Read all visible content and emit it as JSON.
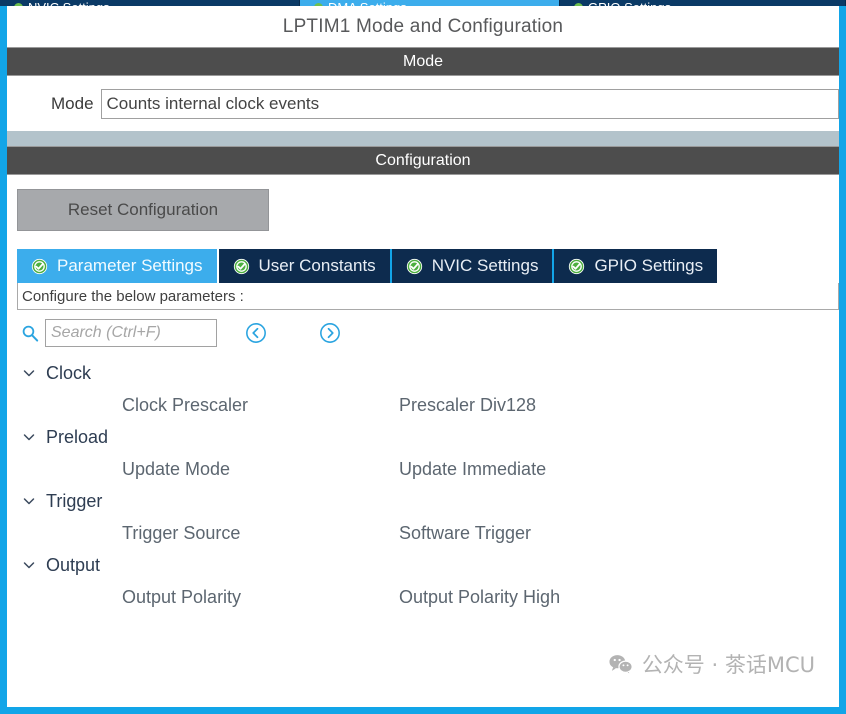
{
  "background_tabs": [
    {
      "label": "NVIC Settings",
      "active": false
    },
    {
      "label": "DMA Settings",
      "active": true
    },
    {
      "label": "GPIO Settings",
      "active": false
    }
  ],
  "dialog": {
    "title": "LPTIM1 Mode and Configuration",
    "mode_section": {
      "header": "Mode",
      "field_label": "Mode",
      "field_value": "Counts internal clock events"
    },
    "configuration_section": {
      "header": "Configuration",
      "reset_button": "Reset Configuration"
    },
    "tabs": [
      {
        "label": "Parameter Settings",
        "icon": "green-check-icon",
        "active": true
      },
      {
        "label": "User Constants",
        "icon": "green-check-icon",
        "active": false
      },
      {
        "label": "NVIC Settings",
        "icon": "green-check-icon",
        "active": false
      },
      {
        "label": "GPIO Settings",
        "icon": "green-check-icon",
        "active": false
      }
    ],
    "parameters_panel": {
      "note": "Configure the below parameters :",
      "search_placeholder": "Search (Ctrl+F)",
      "search_value": "",
      "prev_label": "‹",
      "next_label": "›",
      "groups": [
        {
          "name": "Clock",
          "expanded": true,
          "rows": [
            {
              "name": "Clock Prescaler",
              "value": "Prescaler Div128"
            }
          ]
        },
        {
          "name": "Preload",
          "expanded": true,
          "rows": [
            {
              "name": "Update Mode",
              "value": "Update Immediate"
            }
          ]
        },
        {
          "name": "Trigger",
          "expanded": true,
          "rows": [
            {
              "name": "Trigger Source",
              "value": "Software Trigger"
            }
          ]
        },
        {
          "name": "Output",
          "expanded": true,
          "rows": [
            {
              "name": "Output Polarity",
              "value": "Output Polarity High"
            }
          ]
        }
      ]
    }
  },
  "watermark": {
    "text": "公众号 · 茶话MCU",
    "icon": "wechat-icon"
  },
  "colors": {
    "accent_blue": "#12a5e8",
    "tab_active": "#3cadec",
    "tab_inactive": "#0d2b4e",
    "section_bar": "#4d4d4d",
    "band": "#b3c3cb",
    "check_green": "#4caf3f"
  }
}
